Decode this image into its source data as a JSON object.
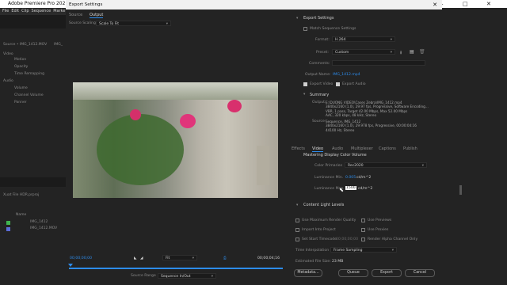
{
  "app": {
    "title": "Adobe Premiere Pro 2021 - E:\\DI",
    "menu": [
      "File",
      "Edit",
      "Clip",
      "Sequence",
      "Marke"
    ],
    "window_controls": [
      "–",
      "□",
      "✕"
    ]
  },
  "background": {
    "source_panel_title": "Source • IMG_1412.MOV",
    "source_tab2": "IMG_",
    "effect_rows": [
      "Video",
      "Motion",
      "Opacity",
      "Time Remapping",
      "Audio",
      "Volume",
      "Channel Volume",
      "Panner"
    ],
    "project_title": "Xuat File HDR.prproj",
    "project_col": "Name",
    "project_items": [
      "IMG_1412",
      "IMG_1412.MOV"
    ]
  },
  "dialog": {
    "title": "Export Settings",
    "close": "✕",
    "left_tabs": [
      "Source",
      "Output"
    ],
    "active_left_tab": "Output",
    "source_scaling_label": "Source Scaling",
    "source_scaling_value": "Scale To Fit",
    "timecode_start": "00;00;00;00",
    "timecode_end": "00;00;04;16",
    "fit_value": "Fit",
    "source_range_label": "Source Range",
    "source_range_value": "Sequence In/Out"
  },
  "export_settings": {
    "section_title": "Export Settings",
    "match_sequence": "Match Sequence Settings",
    "format_label": "Format:",
    "format_value": "H.264",
    "preset_label": "Preset:",
    "preset_value": "Custom",
    "comments_label": "Comments:",
    "output_name_label": "Output Name:",
    "output_name_value": "IMG_1412.mp4",
    "export_video": "Export Video",
    "export_audio": "Export Audio",
    "summary_title": "Summary",
    "output_label": "Output:",
    "output_text": "E:\\DUONG VIDEO\\Cases Zebra\\IMG_1412.mp4\n3840x2160 (1.0), 29.97 fps, Progressive, Software Encoding...\nVBR, 1 pass, Target 42.00 Mbps, Max 52.00 Mbps\nAAC, 320 kbps, 48 kHz, Stereo",
    "source_label": "Source:",
    "source_text": "Sequence, IMG_1412\n3840x2160 (1.0), 29.978 fps, Progressive, 00:00:04:16\n44100 Hz, Stereo"
  },
  "right_tabs": [
    "Effects",
    "Video",
    "Audio",
    "Multiplexer",
    "Captions",
    "Publish"
  ],
  "active_right_tab": "Video",
  "mastering": {
    "title": "Mastering Display Color Volume",
    "color_primaries_label": "Color Primaries",
    "color_primaries_value": "Rec2020",
    "lum_min_label": "Luminance Min.",
    "lum_min_value": "0.005",
    "lum_min_unit": "cd/m^2",
    "lum_max_label": "Luminance Max.",
    "lum_max_value": "1500",
    "lum_max_unit": "cd/m^2",
    "content_light_title": "Content Light Levels"
  },
  "render_options": {
    "max_quality": "Use Maximum Render Quality",
    "use_previews": "Use Previews",
    "import_project": "Import Into Project",
    "use_proxies": "Use Proxies",
    "set_timecode": "Set Start Timecode",
    "timecode_value": "00;00;00;00",
    "render_alpha": "Render Alpha Channel Only",
    "time_interp_label": "Time Interpolation",
    "time_interp_value": "Frame Sampling",
    "file_size_label": "Estimated File Size:",
    "file_size_value": "23 MB"
  },
  "buttons": {
    "metadata": "Metadata...",
    "queue": "Queue",
    "export": "Export",
    "cancel": "Cancel"
  },
  "colors": {
    "accent": "#2d8ceb",
    "panel": "#232323",
    "checked": "#cfcfcf"
  }
}
